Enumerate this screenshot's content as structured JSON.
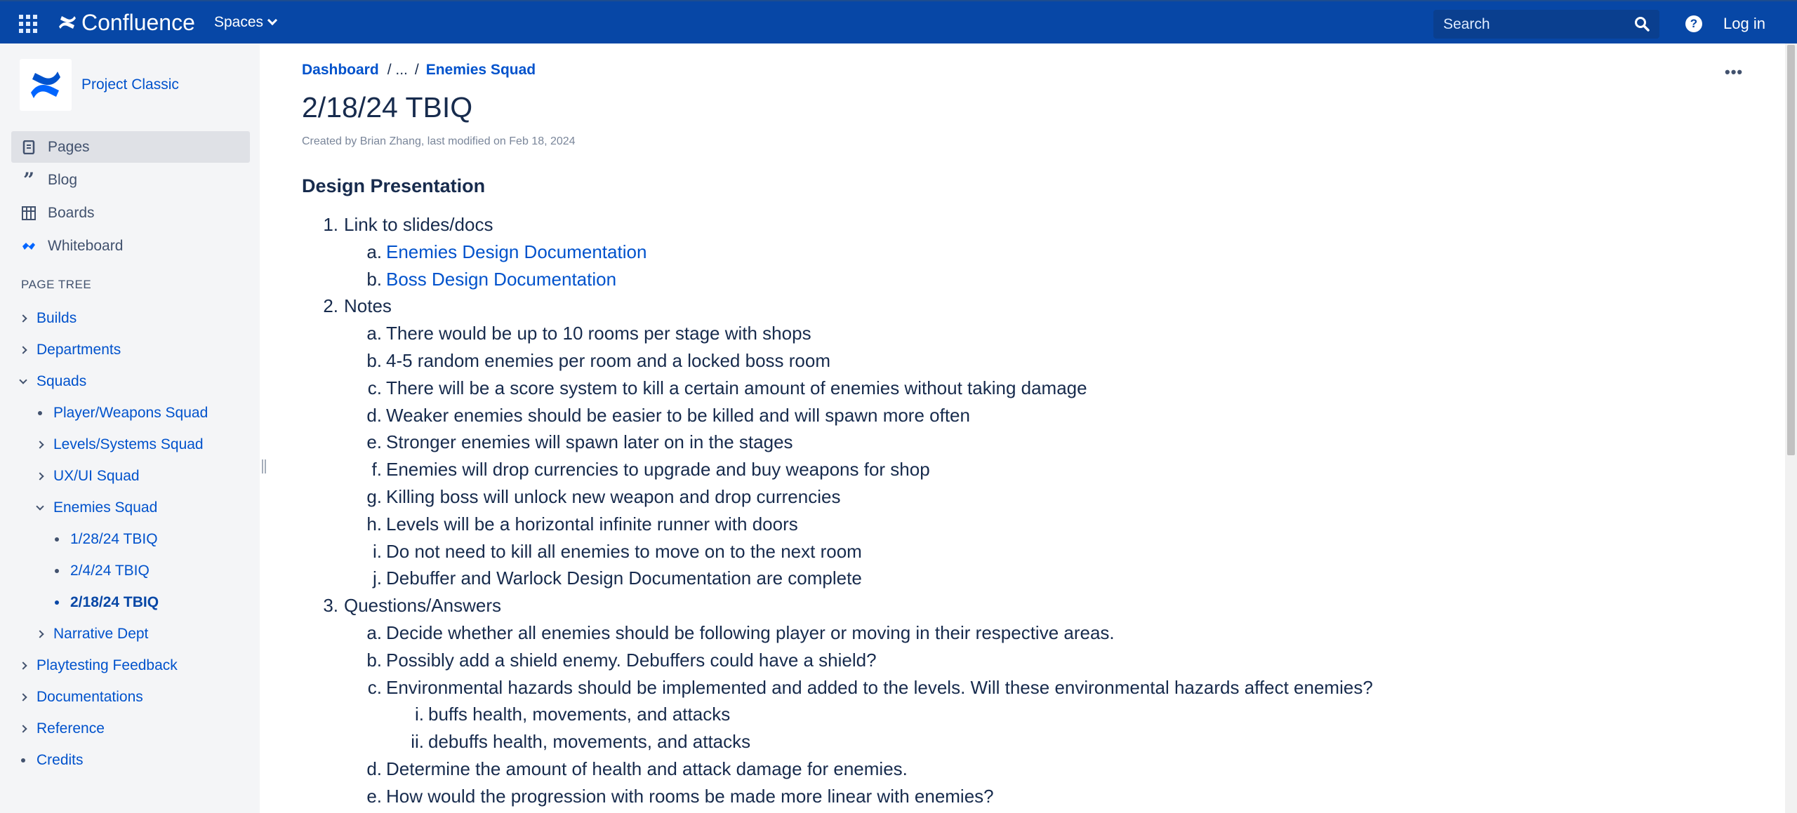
{
  "header": {
    "brand": "Confluence",
    "spaces_label": "Spaces",
    "search_placeholder": "Search",
    "help_label": "?",
    "login_label": "Log in"
  },
  "sidebar": {
    "space_name": "Project Classic",
    "nav": [
      {
        "label": "Pages",
        "icon": "pages-icon",
        "active": true
      },
      {
        "label": "Blog",
        "icon": "quote-icon"
      },
      {
        "label": "Boards",
        "icon": "board-icon"
      },
      {
        "label": "Whiteboard",
        "icon": "whiteboard-icon"
      }
    ],
    "tree_heading": "PAGE TREE",
    "tree": [
      {
        "label": "Builds",
        "state": "collapsed",
        "level": 0
      },
      {
        "label": "Departments",
        "state": "collapsed",
        "level": 0
      },
      {
        "label": "Squads",
        "state": "expanded",
        "level": 0
      },
      {
        "label": "Player/Weapons Squad",
        "state": "leaf",
        "level": 1
      },
      {
        "label": "Levels/Systems Squad",
        "state": "collapsed",
        "level": 1
      },
      {
        "label": "UX/UI Squad",
        "state": "collapsed",
        "level": 1
      },
      {
        "label": "Enemies Squad",
        "state": "expanded",
        "level": 1
      },
      {
        "label": "1/28/24 TBIQ",
        "state": "leaf",
        "level": 2
      },
      {
        "label": "2/4/24 TBIQ",
        "state": "leaf",
        "level": 2
      },
      {
        "label": "2/18/24 TBIQ",
        "state": "leaf",
        "level": 2,
        "current": true
      },
      {
        "label": "Narrative Dept",
        "state": "collapsed",
        "level": 1
      },
      {
        "label": "Playtesting Feedback",
        "state": "collapsed",
        "level": 0
      },
      {
        "label": "Documentations",
        "state": "collapsed",
        "level": 0
      },
      {
        "label": "Reference",
        "state": "collapsed",
        "level": 0
      },
      {
        "label": "Credits",
        "state": "leaf",
        "level": 0
      }
    ]
  },
  "breadcrumb": {
    "root": "Dashboard",
    "ellipsis": "/ ...",
    "separator": "/",
    "parent": "Enemies Squad"
  },
  "page": {
    "title": "2/18/24 TBIQ",
    "meta": "Created by Brian Zhang, last modified on Feb 18, 2024",
    "section_title": "Design Presentation"
  },
  "content": [
    {
      "level": 1,
      "marker": "1.",
      "text": "Link to slides/docs"
    },
    {
      "level": 2,
      "marker": "a.",
      "text": "Enemies Design Documentation",
      "link": true
    },
    {
      "level": 2,
      "marker": "b.",
      "text": "Boss Design Documentation",
      "link": true
    },
    {
      "level": 1,
      "marker": "2.",
      "text": "Notes"
    },
    {
      "level": 2,
      "marker": "a.",
      "text": "There would be up to 10 rooms per stage with shops"
    },
    {
      "level": 2,
      "marker": "b.",
      "text": "4-5 random enemies per room and a locked boss room"
    },
    {
      "level": 2,
      "marker": "c.",
      "text": "There will be a score system to kill a certain amount of enemies without taking damage"
    },
    {
      "level": 2,
      "marker": "d.",
      "text": "Weaker enemies should be easier to be killed and will spawn more often"
    },
    {
      "level": 2,
      "marker": "e.",
      "text": "Stronger enemies will spawn later on in the stages"
    },
    {
      "level": 2,
      "marker": "f.",
      "text": "Enemies will drop currencies to upgrade and buy weapons for shop"
    },
    {
      "level": 2,
      "marker": "g.",
      "text": "Killing boss will unlock new weapon and drop currencies"
    },
    {
      "level": 2,
      "marker": "h.",
      "text": "Levels will be a horizontal infinite runner with doors"
    },
    {
      "level": 2,
      "marker": "i.",
      "text": "Do not need to kill all enemies to move on to the next room"
    },
    {
      "level": 2,
      "marker": "j.",
      "text": "Debuffer and Warlock Design Documentation are complete"
    },
    {
      "level": 1,
      "marker": "3.",
      "text": "Questions/Answers"
    },
    {
      "level": 2,
      "marker": "a.",
      "text": "Decide whether all enemies should be following player or moving in their respective areas."
    },
    {
      "level": 2,
      "marker": "b.",
      "text": "Possibly add a shield enemy. Debuffers could have a shield?"
    },
    {
      "level": 2,
      "marker": "c.",
      "text": "Environmental hazards should be implemented and added to the levels. Will these environmental hazards affect enemies?"
    },
    {
      "level": 3,
      "marker": "i.",
      "text": "buffs health, movements, and attacks"
    },
    {
      "level": 3,
      "marker": "ii.",
      "text": "debuffs health, movements, and attacks"
    },
    {
      "level": 2,
      "marker": "d.",
      "text": "Determine the amount of health and attack damage for enemies."
    },
    {
      "level": 2,
      "marker": "e.",
      "text": "How would the progression with rooms be made more linear with enemies?"
    }
  ],
  "colors": {
    "header_bg": "#0747a6",
    "link": "#0052cc",
    "text": "#172b4d",
    "sidebar_bg": "#f4f5f7"
  }
}
